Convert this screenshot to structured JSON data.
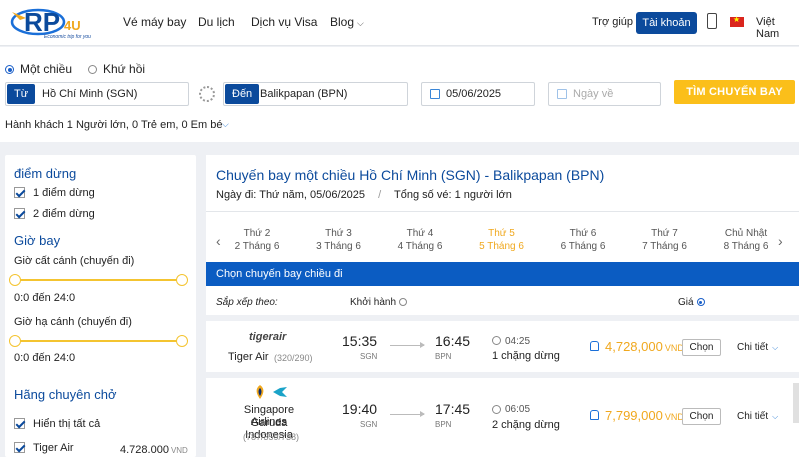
{
  "header": {
    "logo_text": "Economic trip for you",
    "nav": [
      "Vé máy bay",
      "Du lịch",
      "Dịch vụ Visa",
      "Blog"
    ],
    "help": "Trợ giúp",
    "account": "Tài khoản",
    "language": "Việt Nam"
  },
  "search": {
    "one_way": "Một chiều",
    "round_trip": "Khứ hồi",
    "from_tag": "Từ",
    "from_value": "Hồ Chí Minh (SGN)",
    "to_tag": "Đến",
    "to_value": "Balikpapan (BPN)",
    "depart_date": "05/06/2025",
    "return_placeholder": "Ngày về",
    "search_button": "TÌM CHUYẾN BAY",
    "passengers_label": "Hành khách",
    "passengers_value": "1 Người lớn, 0 Trẻ em, 0 Em bé"
  },
  "sidebar": {
    "stops_heading": "điểm dừng",
    "stop_options": [
      "1 điểm dừng",
      "2 điểm dừng"
    ],
    "time_heading": "Giờ bay",
    "depart_label": "Giờ cất cánh (chuyến đi)",
    "depart_range": "0:0 đến 24:0",
    "arrive_label": "Giờ hạ cánh (chuyến đi)",
    "arrive_range": "0:0 đến 24:0",
    "airline_heading": "Hãng chuyên chở",
    "show_all": "Hiển thị tất cả",
    "airline_filter": {
      "name": "Tiger Air",
      "price": "4.728.000",
      "currency": "VND"
    }
  },
  "main": {
    "title": "Chuyến bay một chiều Hồ Chí Minh (SGN) - Balikpapan (BPN)",
    "date_label": "Ngày đi:",
    "date_value": "Thứ năm, 05/06/2025",
    "tickets_label": "Tổng số vé:",
    "tickets_value": "1 người lớn",
    "days": [
      {
        "dow": "Thứ 2",
        "date": "2 Tháng 6"
      },
      {
        "dow": "Thứ 3",
        "date": "3 Tháng 6"
      },
      {
        "dow": "Thứ 4",
        "date": "4 Tháng 6"
      },
      {
        "dow": "Thứ 5",
        "date": "5 Tháng 6"
      },
      {
        "dow": "Thứ 6",
        "date": "6 Tháng 6"
      },
      {
        "dow": "Thứ 7",
        "date": "7 Tháng 6"
      },
      {
        "dow": "Chủ Nhật",
        "date": "8 Tháng 6"
      }
    ],
    "bar_label": "Chọn chuyến bay chiều đi",
    "sort_label": "Sắp xếp theo:",
    "sort_departure": "Khởi hành",
    "sort_price": "Giá",
    "flights": [
      {
        "logo": "tigerair",
        "airline": "Tiger Air",
        "codes": "(320/290)",
        "dep_time": "15:35",
        "dep_apt": "SGN",
        "arr_time": "16:45",
        "arr_apt": "BPN",
        "duration": "04:25",
        "stops": "1 chặng dừng",
        "price": "4,728,000",
        "currency": "VND",
        "choose": "Chọn",
        "detail": "Chi tiết"
      },
      {
        "airline_line1": "Singapore Airlines",
        "airline_line2": "Garuda Indonesia",
        "codes": "(787/359/738)",
        "dep_time": "19:40",
        "dep_apt": "SGN",
        "arr_time": "17:45",
        "arr_apt": "BPN",
        "duration": "06:05",
        "stops": "2 chặng dừng",
        "price": "7,799,000",
        "currency": "VND",
        "choose": "Chọn",
        "detail": "Chi tiết"
      }
    ]
  },
  "colors": {
    "brand": "#0b4a9c",
    "accent": "#fbbf1a",
    "bar": "#0b5cc2",
    "price": "#f0a81e"
  }
}
